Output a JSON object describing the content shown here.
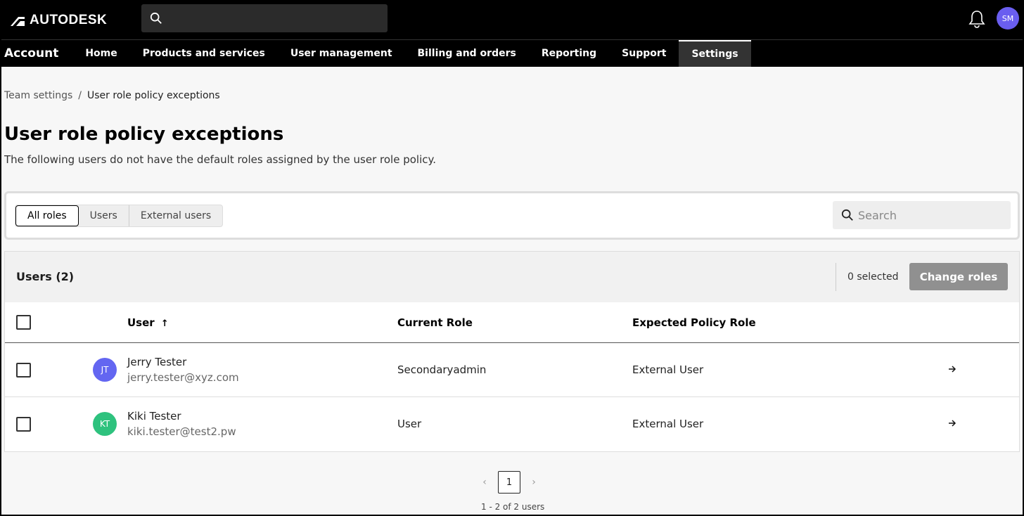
{
  "header": {
    "brand": "AUTODESK",
    "search_placeholder": "",
    "user_initials": "SM"
  },
  "nav": {
    "title": "Account",
    "items": [
      {
        "label": "Home"
      },
      {
        "label": "Products and services"
      },
      {
        "label": "User management"
      },
      {
        "label": "Billing and orders"
      },
      {
        "label": "Reporting"
      },
      {
        "label": "Support"
      },
      {
        "label": "Settings",
        "active": true
      }
    ]
  },
  "breadcrumb": {
    "parent": "Team settings",
    "separator": "/",
    "current": "User role policy exceptions"
  },
  "page": {
    "title": "User role policy exceptions",
    "description": "The following users do not have the default roles assigned by the user role policy."
  },
  "filters": {
    "tabs": [
      "All roles",
      "Users",
      "External users"
    ],
    "active_tab": "All roles",
    "search_placeholder": "Search"
  },
  "table": {
    "count_label": "Users (2)",
    "selected_label": "0 selected",
    "change_roles_label": "Change roles",
    "columns": {
      "user": "User",
      "sort_indicator": "↑",
      "current_role": "Current Role",
      "expected_role": "Expected Policy Role"
    },
    "rows": [
      {
        "initials": "JT",
        "avatar_color": "#6366f1",
        "name": "Jerry Tester",
        "email": "jerry.tester@xyz.com",
        "current_role": "Secondaryadmin",
        "expected_role": "External User"
      },
      {
        "initials": "KT",
        "avatar_color": "#2ec27e",
        "name": "Kiki Tester",
        "email": "kiki.tester@test2.pw",
        "current_role": "User",
        "expected_role": "External User"
      }
    ]
  },
  "pagination": {
    "prev": "‹",
    "current": "1",
    "next": "›",
    "summary": "1 - 2 of 2 users"
  },
  "colors": {
    "brand_bg": "#000000",
    "avatar_user": "#6a5ef0",
    "button_disabled": "#909090"
  }
}
